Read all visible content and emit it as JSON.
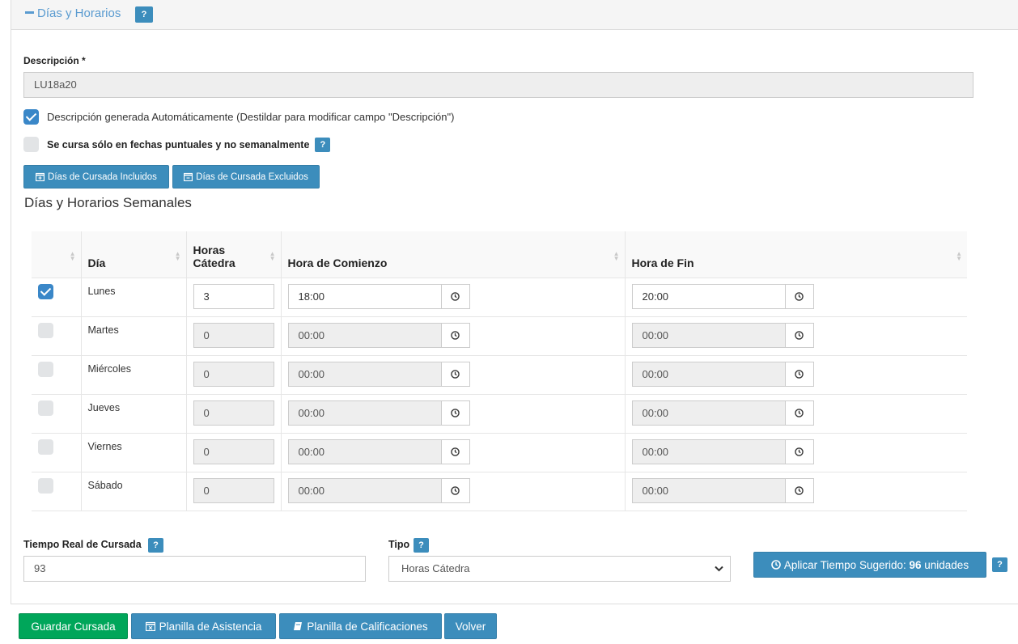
{
  "section": {
    "toggle": "−",
    "title": "Días y Horarios",
    "help": "?"
  },
  "description": {
    "label": "Descripción *",
    "value": "LU18a20"
  },
  "auto_desc": {
    "label": "Descripción generada Automáticamente (Destildar para modificar campo \"Descripción\")",
    "checked": true
  },
  "puntual": {
    "label": "Se cursa sólo en fechas puntuales y no semanalmente",
    "checked": false,
    "help": "?"
  },
  "buttons": {
    "included": "Días de Cursada Incluidos",
    "excluded": "Días de Cursada Excluidos"
  },
  "schedule": {
    "title": "Días y Horarios Semanales",
    "headers": {
      "day": "Día",
      "hours": "Horas Cátedra",
      "start": "Hora de Comienzo",
      "end": "Hora de Fin"
    },
    "rows": [
      {
        "checked": true,
        "day": "Lunes",
        "hours": "3",
        "start": "18:00",
        "end": "20:00"
      },
      {
        "checked": false,
        "day": "Martes",
        "hours": "0",
        "start": "00:00",
        "end": "00:00"
      },
      {
        "checked": false,
        "day": "Miércoles",
        "hours": "0",
        "start": "00:00",
        "end": "00:00"
      },
      {
        "checked": false,
        "day": "Jueves",
        "hours": "0",
        "start": "00:00",
        "end": "00:00"
      },
      {
        "checked": false,
        "day": "Viernes",
        "hours": "0",
        "start": "00:00",
        "end": "00:00"
      },
      {
        "checked": false,
        "day": "Sábado",
        "hours": "0",
        "start": "00:00",
        "end": "00:00"
      }
    ]
  },
  "tiempo_real": {
    "label": "Tiempo Real de Cursada",
    "help": "?",
    "value": "93"
  },
  "tipo": {
    "label": "Tipo",
    "help": "?",
    "selected": "Horas Cátedra"
  },
  "aplicar": {
    "prefix": "Aplicar Tiempo Sugerido: ",
    "value": "96",
    "suffix": " unidades",
    "help": "?"
  },
  "footer": {
    "save": "Guardar Cursada",
    "attendance": "Planilla de Asistencia",
    "grades": "Planilla de Calificaciones",
    "back": "Volver"
  },
  "colors": {
    "primary": "#3c8dbc",
    "success": "#00a65a",
    "checkbox_on": "#3a87c8"
  }
}
